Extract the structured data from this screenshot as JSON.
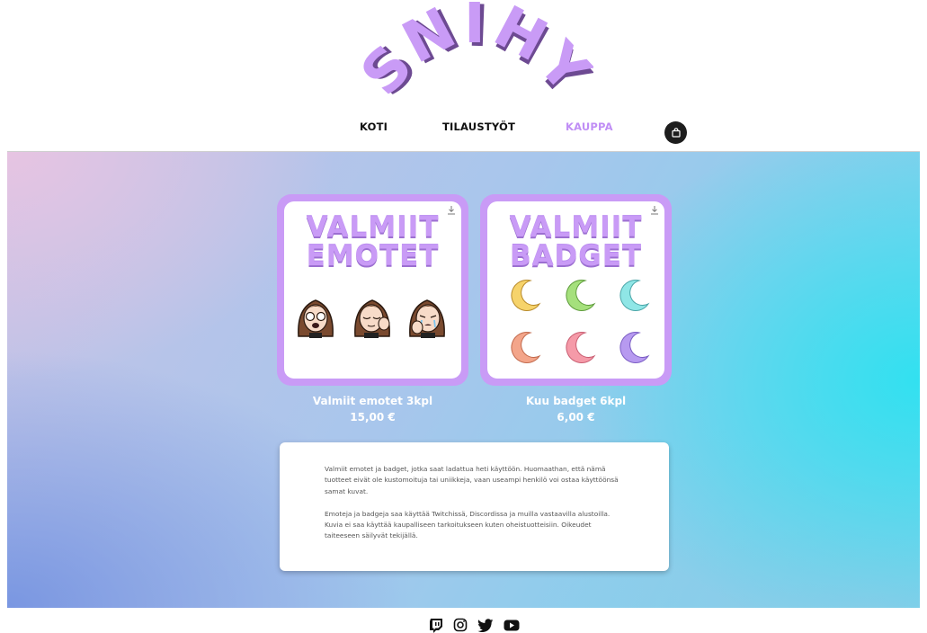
{
  "brand": {
    "logo_text": "SNIHY",
    "color": "#c99bf6"
  },
  "nav": {
    "items": [
      {
        "label": "KOTI",
        "active": false
      },
      {
        "label": "TILAUSTYÖT",
        "active": false
      },
      {
        "label": "KAUPPA",
        "active": true
      }
    ],
    "cart_icon": "shopping-bag-icon"
  },
  "products": [
    {
      "title_line1": "VALMIIT",
      "title_line2": "EMOTET",
      "name": "Valmiit emotet 3kpl",
      "price": "15,00 €",
      "badge_icon": "download-icon"
    },
    {
      "title_line1": "VALMIIT",
      "title_line2": "BADGET",
      "name": "Kuu badget 6kpl",
      "price": "6,00 €",
      "badge_icon": "download-icon",
      "moon_colors": [
        "#f6d36b",
        "#a5e07c",
        "#8fe6e6",
        "#f3a58a",
        "#f59aa8",
        "#b79af0"
      ]
    }
  ],
  "description": {
    "paragraph1": "Valmiit emotet ja badget, jotka saat ladattua heti käyttöön. Huomaathan, että nämä tuotteet eivät ole kustomoituja tai uniikkeja, vaan useampi henkilö voi ostaa käyttöönsä samat kuvat.",
    "paragraph2": "Emoteja ja badgeja saa käyttää Twitchissä, Discordissa ja muilla vastaavilla alustoilla. Kuvia ei saa käyttää kaupalliseen tarkoitukseen kuten oheistuotteisiin. Oikeudet taiteeseen säilyvät tekijällä."
  },
  "footer": {
    "social": [
      "twitch-icon",
      "instagram-icon",
      "twitter-icon",
      "youtube-icon"
    ]
  }
}
